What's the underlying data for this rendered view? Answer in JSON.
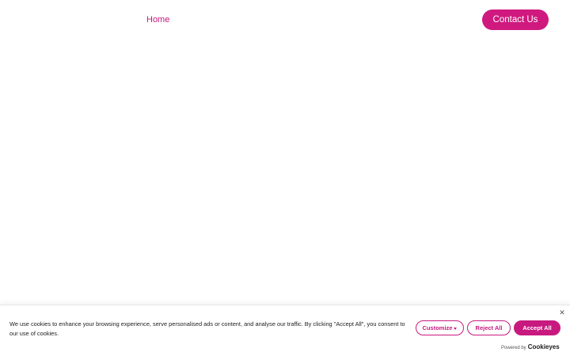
{
  "header": {
    "nav_home": "Home",
    "contact_label": "Contact Us"
  },
  "cookie_banner": {
    "message": "We use cookies to enhance your browsing experience, serve personalised ads or content, and analyse our traffic. By clicking \"Accept All\", you consent to our use of cookies.",
    "close_icon": "close-icon",
    "customize_label": "Customize",
    "reject_label": "Reject All",
    "accept_label": "Accept All",
    "powered_by": "Powered by",
    "brand": "Cookieyes"
  },
  "colors": {
    "accent": "#c8197f",
    "background": "#ffffff",
    "text": "#212121"
  }
}
